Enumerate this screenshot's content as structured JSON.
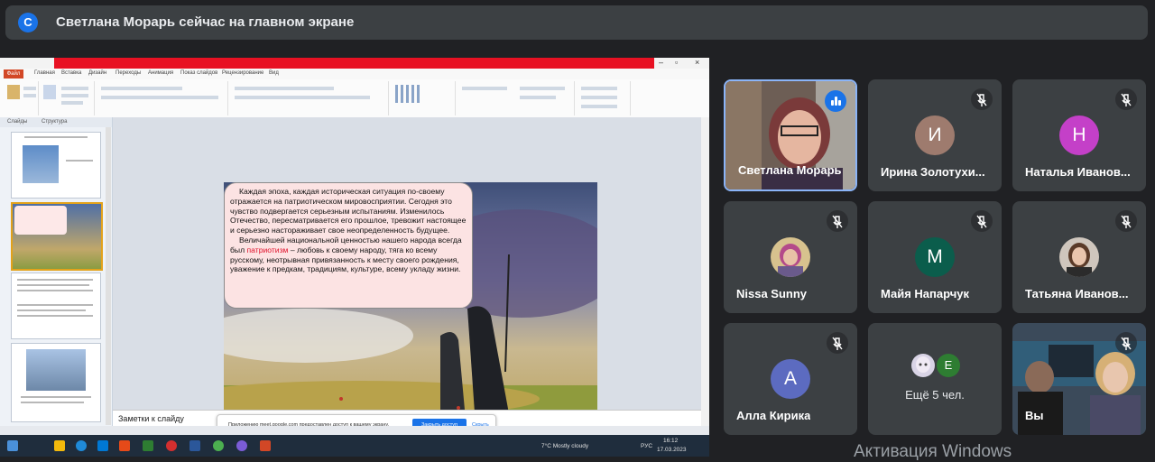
{
  "header": {
    "presenter_initial": "С",
    "title": "Светлана Морарь сейчас на главном экране"
  },
  "presentation": {
    "slide_text_p1": "Каждая эпоха, каждая историческая ситуация по-своему отражается на патриотическом мировосприятии. Сегодня это чувство подвергается серьезным испытаниям. Изменилось Отечество, пересматривается его прошлое, тревожит настоящее и серьезно настораживает свое неопределенность будущее.",
    "slide_text_p2_before": "Величайшей национальной ценностью нашего народа всегда был ",
    "slide_text_p2_highlight": "патриотизм",
    "slide_text_p2_after": " – любовь к своему народу, тяга ко всему русскому, неотрывная привязанность к месту своего рождения, уважение к предкам, традициям, культуре, всему укладу жизни.",
    "notes_placeholder": "Заметки к слайду",
    "share_notice": "Приложению meet.google.com предоставлен доступ к вашему экрану.",
    "stop_sharing": "Закрыть доступ",
    "hide": "Скрыть",
    "weather": "7°C  Mostly cloudy",
    "lang": "РУС",
    "time": "16:12",
    "date": "17.03.2023",
    "slides_tab": "Слайды",
    "outline_tab": "Структура",
    "file_tab": "Файл"
  },
  "participants": [
    {
      "name": "Светлана Морарь",
      "type": "video",
      "speaking": true
    },
    {
      "name": "Ирина Золотухи...",
      "type": "letter",
      "letter": "И",
      "color": "#9e7b6e",
      "muted": true
    },
    {
      "name": "Наталья Иванов...",
      "type": "letter",
      "letter": "Н",
      "color": "#c440c8",
      "muted": true
    },
    {
      "name": "Nissa Sunny",
      "type": "photo",
      "muted": true
    },
    {
      "name": "Майя Напарчук",
      "type": "letter",
      "letter": "М",
      "color": "#0b5d4c",
      "muted": true
    },
    {
      "name": "Татьяна Иванов...",
      "type": "photo",
      "muted": true
    },
    {
      "name": "Алла Кирика",
      "type": "letter",
      "letter": "А",
      "color": "#5c6bc0",
      "muted": true
    },
    {
      "name": "Ещё 5 чел.",
      "type": "group",
      "small_letter": "Е",
      "small_color": "#2e7d32"
    },
    {
      "name": "Вы",
      "type": "video",
      "muted": true
    }
  ],
  "watermark": "Активация Windows",
  "colors": {
    "meet_bg": "#202124",
    "tile_bg": "#3c4043",
    "accent": "#1a73e8"
  }
}
